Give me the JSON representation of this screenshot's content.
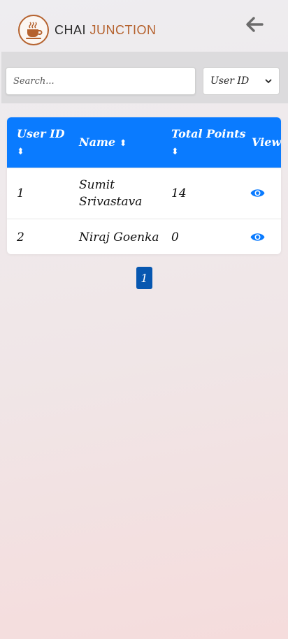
{
  "header": {
    "brand_word1": "CHAI",
    "brand_word2": "JUNCTION",
    "logo_icon": "chai-cup-icon",
    "back_icon": "arrow-left-icon"
  },
  "filters": {
    "search_placeholder": "Search...",
    "search_value": "",
    "filter_selected": "User ID"
  },
  "table": {
    "columns": {
      "user_id": "User ID",
      "name": "Name",
      "total_points": "Total Points",
      "view": "View"
    },
    "sort_glyph": "⬍",
    "view_icon": "eye-icon",
    "rows": [
      {
        "user_id": "1",
        "name_line1": "Sumit",
        "name_line2": "Srivastava",
        "total_points": "14"
      },
      {
        "user_id": "2",
        "name_line1": "Niraj Goenka",
        "name_line2": "",
        "total_points": "0"
      }
    ]
  },
  "pagination": {
    "current_page": "1"
  },
  "colors": {
    "accent": "#0a7bff",
    "pager": "#0757b0",
    "brand": "#b5622e"
  }
}
